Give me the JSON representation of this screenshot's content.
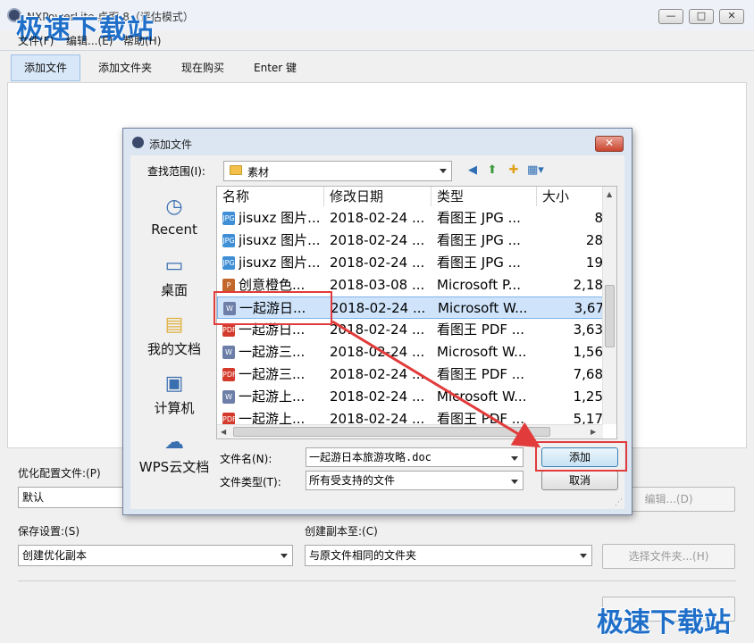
{
  "window": {
    "title": "NXPowerLite 桌面 8（评估模式）",
    "watermark": "极速下载站",
    "controls": {
      "minimize": "—",
      "maximize": "□",
      "close": "✕"
    }
  },
  "menu": {
    "file": "文件(F)",
    "edit": "编辑...(E)",
    "help": "帮助(H)"
  },
  "toolbar": {
    "add_file": "添加文件",
    "add_folder": "添加文件夹",
    "buy_now": "现在购买",
    "enter_key": "Enter 键"
  },
  "lower": {
    "profile_label": "优化配置文件:(P)",
    "profile_value": "默认",
    "edit_button": "编辑...(D)",
    "save_label": "保存设置:(S)",
    "save_value": "创建优化副本",
    "copy_to_label": "创建副本至:(C)",
    "copy_to_value": "与原文件相同的文件夹",
    "choose_folder_button": "选择文件夹...(H)"
  },
  "dialog": {
    "title": "添加文件",
    "close": "✕",
    "look_in_label": "查找范围(I):",
    "look_in_value": "素材",
    "places": [
      {
        "label": "Recent",
        "icon": "recent-places-icon"
      },
      {
        "label": "桌面",
        "icon": "desktop-icon"
      },
      {
        "label": "我的文档",
        "icon": "my-documents-icon"
      },
      {
        "label": "计算机",
        "icon": "computer-icon"
      },
      {
        "label": "WPS云文档",
        "icon": "cloud-icon"
      }
    ],
    "columns": [
      "名称",
      "修改日期",
      "类型",
      "大小"
    ],
    "rows": [
      {
        "name": "jisuxz 图片...",
        "date": "2018-02-24 ...",
        "type": "看图王 JPG ...",
        "size": "8",
        "icon": "jpg-icon"
      },
      {
        "name": "jisuxz 图片...",
        "date": "2018-02-24 ...",
        "type": "看图王 JPG ...",
        "size": "28",
        "icon": "jpg-icon"
      },
      {
        "name": "jisuxz 图片...",
        "date": "2018-02-24 ...",
        "type": "看图王 JPG ...",
        "size": "19",
        "icon": "jpg-icon"
      },
      {
        "name": "创意橙色...",
        "date": "2018-03-08 ...",
        "type": "Microsoft P...",
        "size": "2,18",
        "icon": "ppt-icon"
      },
      {
        "name": "一起游日...",
        "date": "2018-02-24 ...",
        "type": "Microsoft W...",
        "size": "3,67",
        "icon": "doc-icon"
      },
      {
        "name": "一起游日...",
        "date": "2018-02-24 ...",
        "type": "看图王 PDF ...",
        "size": "3,63",
        "icon": "pdf-icon"
      },
      {
        "name": "一起游三...",
        "date": "2018-02-24 ...",
        "type": "Microsoft W...",
        "size": "1,56",
        "icon": "doc-icon"
      },
      {
        "name": "一起游三...",
        "date": "2018-02-24 ...",
        "type": "看图王 PDF ...",
        "size": "7,68",
        "icon": "pdf-icon"
      },
      {
        "name": "一起游上...",
        "date": "2018-02-24 ...",
        "type": "Microsoft W...",
        "size": "1,25",
        "icon": "doc-icon"
      },
      {
        "name": "一起游上...",
        "date": "2018-02-24 ...",
        "type": "看图王 PDF ...",
        "size": "5,17",
        "icon": "pdf-icon"
      }
    ],
    "selected_row": 4,
    "filename_label": "文件名(N):",
    "filename_value": "一起游日本旅游攻略.doc",
    "filetype_label": "文件类型(T):",
    "filetype_value": "所有受支持的文件",
    "add_button": "添加",
    "cancel_button": "取消"
  },
  "colors": {
    "annotation_red": "#e23b3b",
    "watermark_blue": "#1f6fc9",
    "selection": "#cfe4fb"
  }
}
